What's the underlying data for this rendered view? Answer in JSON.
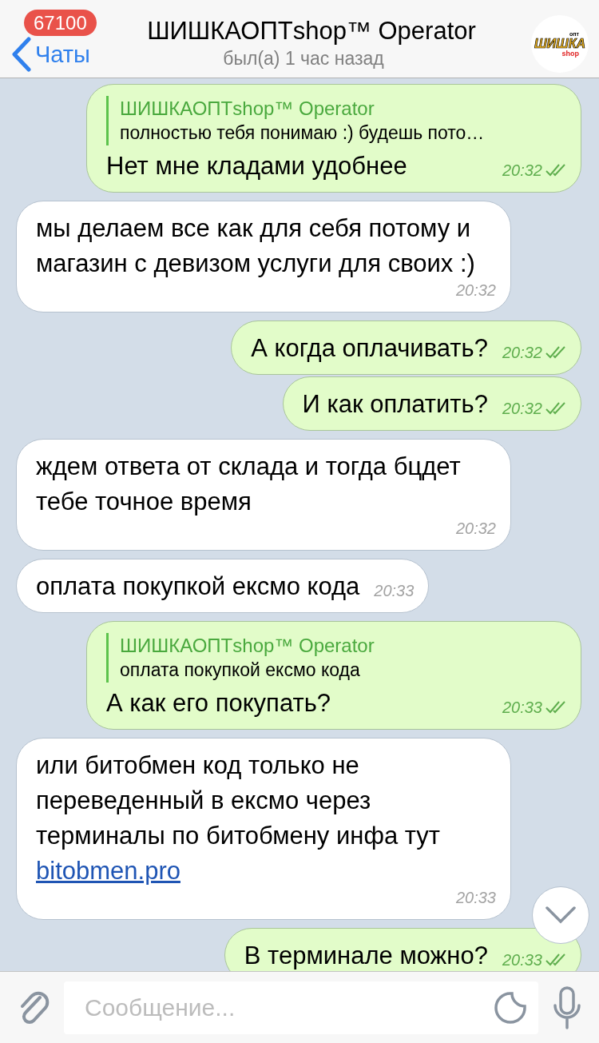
{
  "header": {
    "back_label": "Чаты",
    "unread_badge": "67100",
    "title": "ШИШКАОПТshop™ Operator",
    "status": "был(а) 1 час назад",
    "avatar": {
      "wordmark": "ШИШКА",
      "sub": "shop",
      "tag": "опт"
    }
  },
  "messages": [
    {
      "kind": "out",
      "reply": {
        "author": "ШИШКАОПТshop™ Operator",
        "text": "полностью тебя понимаю :) будешь пото…"
      },
      "text": "Нет мне кладами удобнее",
      "time": "20:32",
      "read": true
    },
    {
      "kind": "in",
      "text": "мы делаем все как для себя потому и магазин с девизом услуги для своих :)",
      "time": "20:32"
    },
    {
      "kind": "out",
      "text": "А когда оплачивать?",
      "time": "20:32",
      "read": true
    },
    {
      "kind": "out",
      "text": "И как оплатить?",
      "time": "20:32",
      "read": true
    },
    {
      "kind": "in",
      "text": "ждем ответа от склада и тогда бцдет тебе точное время",
      "time": "20:32"
    },
    {
      "kind": "in",
      "text": "оплата покупкой ексмо кода",
      "time": "20:33"
    },
    {
      "kind": "out",
      "reply": {
        "author": "ШИШКАОПТshop™ Operator",
        "text": "оплата покупкой ексмо кода"
      },
      "text": "А как его покупать?",
      "time": "20:33",
      "read": true
    },
    {
      "kind": "in",
      "text": "или битобмен код только не переведенный в ексмо через терминалы по битобмену инфа тут",
      "link": "bitobmen.pro",
      "time": "20:33"
    },
    {
      "kind": "out",
      "text": "В терминале можно?",
      "time": "20:33",
      "read": true
    }
  ],
  "composer": {
    "placeholder": "Сообщение..."
  }
}
